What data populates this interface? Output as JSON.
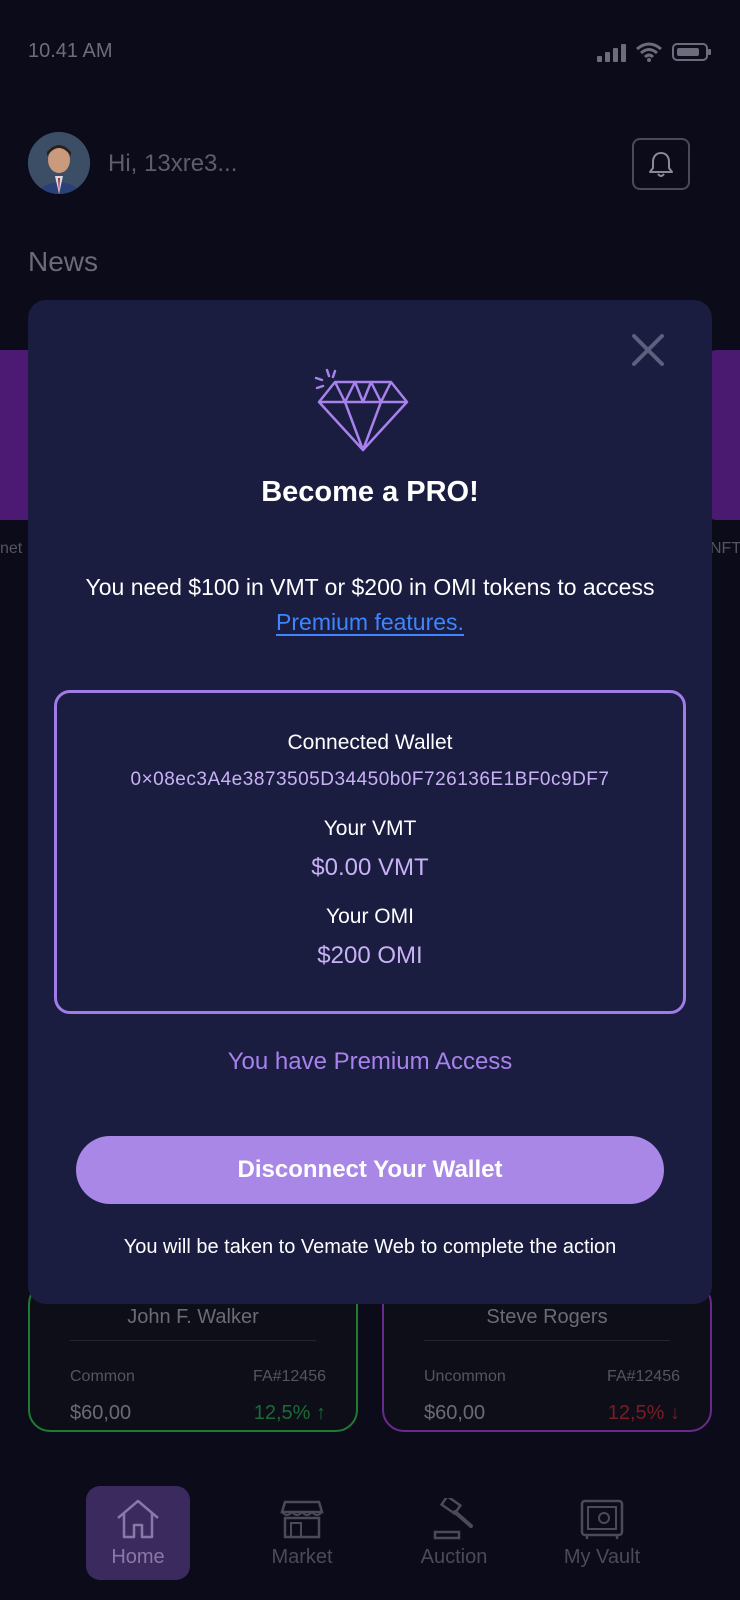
{
  "status_bar": {
    "time": "10.41 AM"
  },
  "header": {
    "greeting": "Hi, 13xre3..."
  },
  "news": {
    "title": "News",
    "left_caption": "net",
    "right_caption": "NFT"
  },
  "modal": {
    "title": "Become a PRO!",
    "description_prefix": "You need $100 in VMT or $200 in OMI tokens to access ",
    "premium_link": "Premium features.",
    "wallet": {
      "connected_label": "Connected Wallet",
      "address": "0×08ec3A4e3873505D34450b0F726136E1BF0c9DF7",
      "vmt_label": "Your VMT",
      "vmt_value": "$0.00 VMT",
      "omi_label": "Your OMI",
      "omi_value": "$200 OMI"
    },
    "premium_status": "You have Premium Access",
    "disconnect_label": "Disconnect Your Wallet",
    "footnote": "You will be taken to Vemate Web to complete the action"
  },
  "players": [
    {
      "name": "John F. Walker",
      "rarity": "Common",
      "id": "FA#12456",
      "price": "$60,00",
      "change": "12,5%",
      "direction": "up",
      "arrow": "↑"
    },
    {
      "name": "Steve Rogers",
      "rarity": "Uncommon",
      "id": "FA#12456",
      "price": "$60,00",
      "change": "12,5%",
      "direction": "down",
      "arrow": "↓"
    }
  ],
  "nav": [
    {
      "label": "Home",
      "icon": "home-icon",
      "active": true
    },
    {
      "label": "Market",
      "icon": "store-icon",
      "active": false
    },
    {
      "label": "Auction",
      "icon": "gavel-icon",
      "active": false
    },
    {
      "label": "My Vault",
      "icon": "vault-icon",
      "active": false
    }
  ],
  "colors": {
    "background": "#0b0b1a",
    "modal": "#1a1c40",
    "accent": "#a887e6",
    "link": "#3d86ff"
  }
}
